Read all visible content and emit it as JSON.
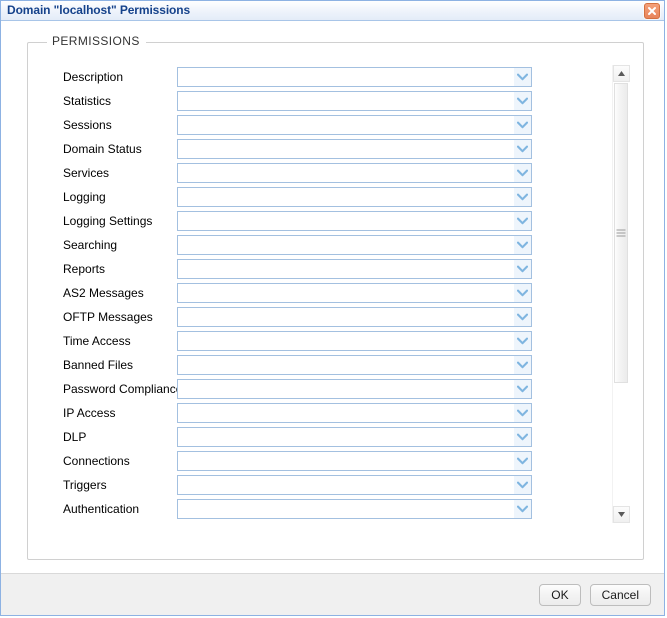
{
  "window": {
    "title": "Domain \"localhost\" Permissions",
    "close_icon": "close-icon"
  },
  "fieldset": {
    "legend": "PERMISSIONS"
  },
  "permissions": {
    "rows": [
      {
        "label": "Description",
        "value": ""
      },
      {
        "label": "Statistics",
        "value": ""
      },
      {
        "label": "Sessions",
        "value": ""
      },
      {
        "label": "Domain Status",
        "value": ""
      },
      {
        "label": "Services",
        "value": ""
      },
      {
        "label": "Logging",
        "value": ""
      },
      {
        "label": "Logging Settings",
        "value": ""
      },
      {
        "label": "Searching",
        "value": ""
      },
      {
        "label": "Reports",
        "value": ""
      },
      {
        "label": "AS2 Messages",
        "value": ""
      },
      {
        "label": "OFTP Messages",
        "value": ""
      },
      {
        "label": "Time Access",
        "value": ""
      },
      {
        "label": "Banned Files",
        "value": ""
      },
      {
        "label": "Password Compliance",
        "value": ""
      },
      {
        "label": "IP Access",
        "value": ""
      },
      {
        "label": "DLP",
        "value": ""
      },
      {
        "label": "Connections",
        "value": ""
      },
      {
        "label": "Triggers",
        "value": ""
      },
      {
        "label": "Authentication",
        "value": ""
      },
      {
        "label": "",
        "value": ""
      }
    ]
  },
  "scrollbar": {
    "up_icon": "triangle-up-icon",
    "down_icon": "triangle-down-icon",
    "thumb_icon": "scrollbar-thumb-grip"
  },
  "footer": {
    "ok_label": "OK",
    "cancel_label": "Cancel"
  },
  "colors": {
    "title_text": "#15428b",
    "window_border": "#8db2e3",
    "combo_border": "#a3c0e0",
    "combo_arrow": "#7fb5e0",
    "close_button": "#e8845a",
    "footer_bg": "#f0f0f0"
  }
}
